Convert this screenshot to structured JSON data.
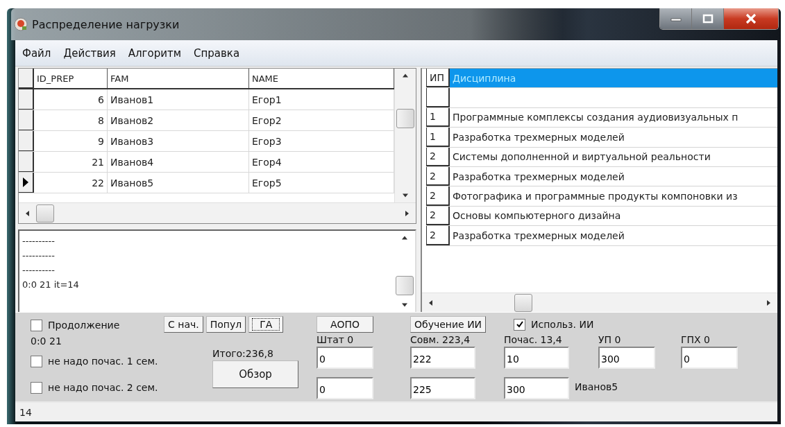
{
  "window": {
    "title": "Распределение нагрузки"
  },
  "menu": [
    "Файл",
    "Действия",
    "Алгоритм",
    "Справка"
  ],
  "teachers_table": {
    "columns": [
      "ID_PREP",
      "FAM",
      "NAME"
    ],
    "rows": [
      {
        "cells": [
          "6",
          "Иванов1",
          "Егор1"
        ],
        "current": false
      },
      {
        "cells": [
          "8",
          "Иванов2",
          "Егор2"
        ],
        "current": false
      },
      {
        "cells": [
          "9",
          "Иванов3",
          "Егор3"
        ],
        "current": false
      },
      {
        "cells": [
          "21",
          "Иванов4",
          "Егор4"
        ],
        "current": false
      },
      {
        "cells": [
          "22",
          "Иванов5",
          "Егор5"
        ],
        "current": true
      }
    ]
  },
  "log": {
    "lines": [
      "----------",
      "----------",
      "----------",
      "0:0 21 it=14"
    ]
  },
  "disciplines_table": {
    "columns": [
      {
        "label": "ИП",
        "selected": false
      },
      {
        "label": "Дисциплина",
        "selected": true
      }
    ],
    "rows": [
      {
        "kind": "blank"
      },
      {
        "kind": "data",
        "cells": [
          "1",
          "Программные комплексы создания аудиовизуальных п"
        ]
      },
      {
        "kind": "data",
        "cells": [
          "1",
          "Разработка трехмерных моделей"
        ]
      },
      {
        "kind": "data",
        "cells": [
          "2",
          "Системы дополненной и виртуальной реальности"
        ]
      },
      {
        "kind": "data",
        "cells": [
          "2",
          "Разработка трехмерных моделей"
        ]
      },
      {
        "kind": "data",
        "cells": [
          "2",
          "Фотографика и программные продукты компоновки из"
        ]
      },
      {
        "kind": "data",
        "cells": [
          "2",
          "Основы компьютерного дизайна"
        ]
      },
      {
        "kind": "data",
        "cells": [
          "2",
          "Разработка трехмерных моделей"
        ]
      }
    ]
  },
  "bottom_panel": {
    "continue_checkbox": {
      "label": "Продолжение",
      "checked": false
    },
    "buttons": [
      {
        "label": "С нач.",
        "focused": false
      },
      {
        "label": "Попул",
        "focused": false
      },
      {
        "label": "ГА",
        "focused": true
      }
    ],
    "progress_text": "0:0 21",
    "semester_checkboxes": [
      {
        "label": "не надо почас. 1 сем.",
        "checked": false
      },
      {
        "label": "не надо почас. 2 сем.",
        "checked": false
      }
    ],
    "total": "Итого:236,8",
    "overview_button": "Обзор",
    "columns": [
      {
        "button": "АОПО",
        "label": "Штат 0",
        "fields": [
          "0",
          "0"
        ]
      },
      {
        "button": "Обучение ИИ",
        "label": "Совм. 223,4",
        "fields": [
          "222",
          "225"
        ]
      },
      {
        "checkbox": {
          "label": "Использ. ИИ",
          "checked": true
        },
        "label": "Почас. 13,4",
        "fields": [
          "10",
          "300"
        ],
        "note": "Иванов5"
      },
      {
        "label": "УП 0",
        "fields": [
          "300"
        ]
      },
      {
        "label": "ГПХ 0",
        "fields": [
          "0"
        ]
      }
    ]
  },
  "status_bar": {
    "text": "14"
  }
}
